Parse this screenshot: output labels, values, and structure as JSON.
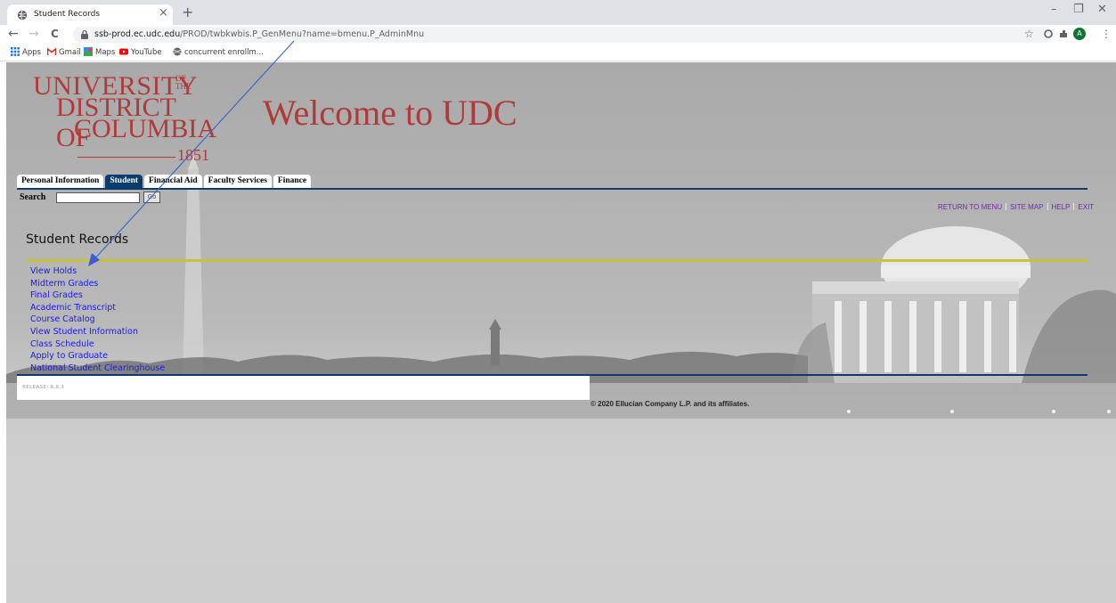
{
  "browser": {
    "tab_title": "Student Records",
    "tab_close": "×",
    "new_tab": "+",
    "url_host": "ssb-prod.ec.udc.edu",
    "url_path": "/PROD/twbkwbis.P_GenMenu?name=bmenu.P_AdminMnu",
    "window_controls": {
      "minimize": "–",
      "restore": "❐",
      "close": "✕"
    },
    "nav": {
      "back": "←",
      "forward": "→",
      "reload": "C"
    },
    "bookmarks": [
      "Apps",
      "Gmail",
      "Maps",
      "YouTube",
      "concurrent enrollm..."
    ],
    "avatar_letter": "A"
  },
  "header": {
    "logo": {
      "line1": "UNIVERSITY",
      "of_the": "OF THE",
      "line2": "DISTRICT OF",
      "line3": "COLUMBIA",
      "year": "1851"
    },
    "welcome": "Welcome to UDC"
  },
  "nav_tabs": [
    {
      "label": "Personal Information",
      "active": false
    },
    {
      "label": "Student",
      "active": true
    },
    {
      "label": "Financial Aid",
      "active": false
    },
    {
      "label": "Faculty Services",
      "active": false
    },
    {
      "label": "Finance",
      "active": false
    }
  ],
  "search": {
    "label": "Search",
    "value": "",
    "go_label": "Go"
  },
  "top_links": [
    "RETURN TO MENU",
    "SITE MAP",
    "HELP",
    "EXIT"
  ],
  "section_title": "Student Records",
  "menu_items": [
    "View Holds",
    "Midterm Grades",
    "Final Grades",
    "Academic Transcript",
    "Course Catalog",
    "View Student Information",
    "Class Schedule",
    "Apply to Graduate",
    "National Student Clearinghouse"
  ],
  "footer": {
    "release": "RELEASE: 8.8.3",
    "copyright": "© 2020 Ellucian Company L.P. and its affiliates."
  },
  "colors": {
    "brand_red": "#b03a3a",
    "nav_blue": "#0b3c6e",
    "link_blue": "#1a1aee",
    "top_link_purple": "#6b2ea8",
    "rule_yellow": "#c9c33b",
    "annotation_arrow": "#3a5fcd"
  }
}
